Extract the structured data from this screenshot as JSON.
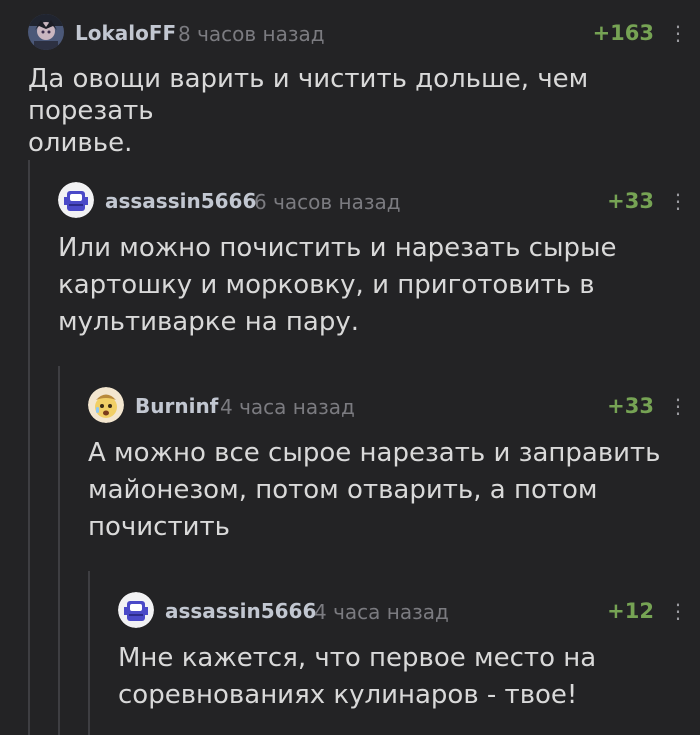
{
  "comments": [
    {
      "user": "LokaloFF",
      "time": "8 часов назад",
      "rating": "+163",
      "text": "Да овощи варить и чистить дольше, чем порезать\nоливье."
    },
    {
      "user": "assassin5666",
      "time": "6 часов назад",
      "rating": "+33",
      "text": "Или можно почистить и нарезать сырые\nкартошку и морковку, и приготовить в\nмультиварке на пару."
    },
    {
      "user": "Burninf",
      "time": "4 часа назад",
      "rating": "+33",
      "text": "А можно все сырое нарезать и заправить\nмайонезом, потом отварить, а потом\nпочистить"
    },
    {
      "user": "assassin5666",
      "time": "4 часа назад",
      "rating": "+12",
      "text": "Мне кажется, что первое место на\nсоревнованиях кулинаров - твое!"
    }
  ],
  "icons": {
    "avatar_1": "anime-avatar",
    "avatar_2": "robot-avatar",
    "avatar_3": "surprised-emoji-avatar",
    "avatar_4": "robot-avatar",
    "more": "more-vertical-icon"
  },
  "colors": {
    "background": "#232325",
    "text": "#d9d9d9",
    "username": "#c2c7d1",
    "time": "#7b7b80",
    "rating": "#76a354",
    "thread_line": "#3e3e42"
  }
}
